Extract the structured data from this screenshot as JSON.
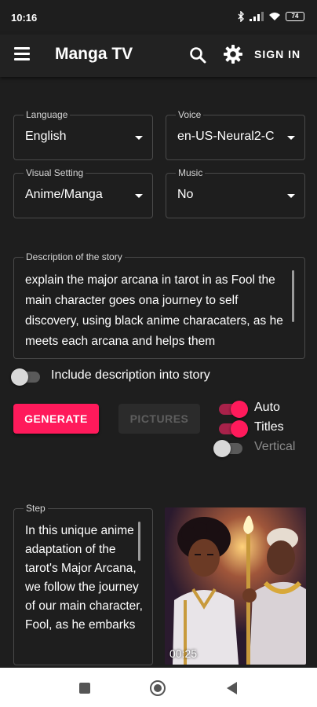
{
  "status_bar": {
    "time": "10:16",
    "battery": "74"
  },
  "app_bar": {
    "title": "Manga TV",
    "sign_in_label": "SIGN IN"
  },
  "settings": {
    "language": {
      "label": "Language",
      "value": "English"
    },
    "voice": {
      "label": "Voice",
      "value": "en-US-Neural2-C"
    },
    "visual_setting": {
      "label": "Visual Setting",
      "value": "Anime/Manga"
    },
    "music": {
      "label": "Music",
      "value": "No"
    }
  },
  "description": {
    "label": "Description of the story",
    "value": "explain the major arcana in tarot in as Fool the main character goes ona  journey to self discovery, using black anime characaters, as he meets each arcana and helps them"
  },
  "include_toggle": {
    "label": "Include description into story",
    "on": false
  },
  "actions": {
    "generate_label": "GENERATE",
    "pictures_label": "PICTURES",
    "pictures_enabled": false
  },
  "options": {
    "auto": {
      "label": "Auto",
      "on": true
    },
    "titles": {
      "label": "Titles",
      "on": true
    },
    "vertical": {
      "label": "Vertical",
      "on": false
    }
  },
  "step": {
    "label": "Step",
    "text": "In this unique anime adaptation of the tarot's Major Arcana, we follow the journey of our main character, Fool, as he embarks"
  },
  "preview": {
    "duration": "00:25"
  },
  "colors": {
    "accent": "#ff1a5b",
    "background": "#1e1e1e",
    "app_bar": "#222222",
    "field_border": "#4a4a4a"
  },
  "icons": {
    "menu": "hamburger-menu-icon",
    "search": "search-icon",
    "settings": "gear-icon",
    "dropdown": "caret-down-icon",
    "nav_recents": "square-icon",
    "nav_home": "circle-icon",
    "nav_back": "triangle-back-icon"
  }
}
